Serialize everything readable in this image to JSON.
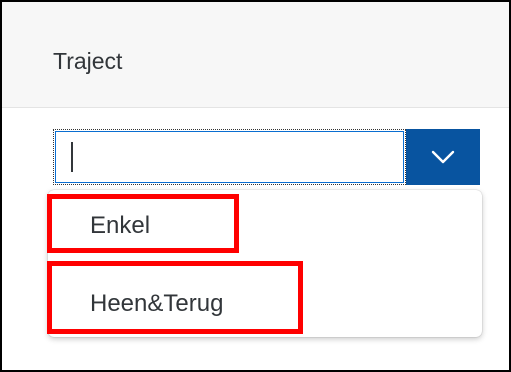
{
  "field": {
    "label": "Traject",
    "value": ""
  },
  "dropdown": {
    "button_icon": "chevron-down-icon",
    "options": [
      {
        "label": "Enkel"
      },
      {
        "label": "Heen&Terug"
      }
    ]
  },
  "colors": {
    "button": "#0854a0",
    "highlight": "#ff0000",
    "header_bg": "#f7f7f7"
  }
}
